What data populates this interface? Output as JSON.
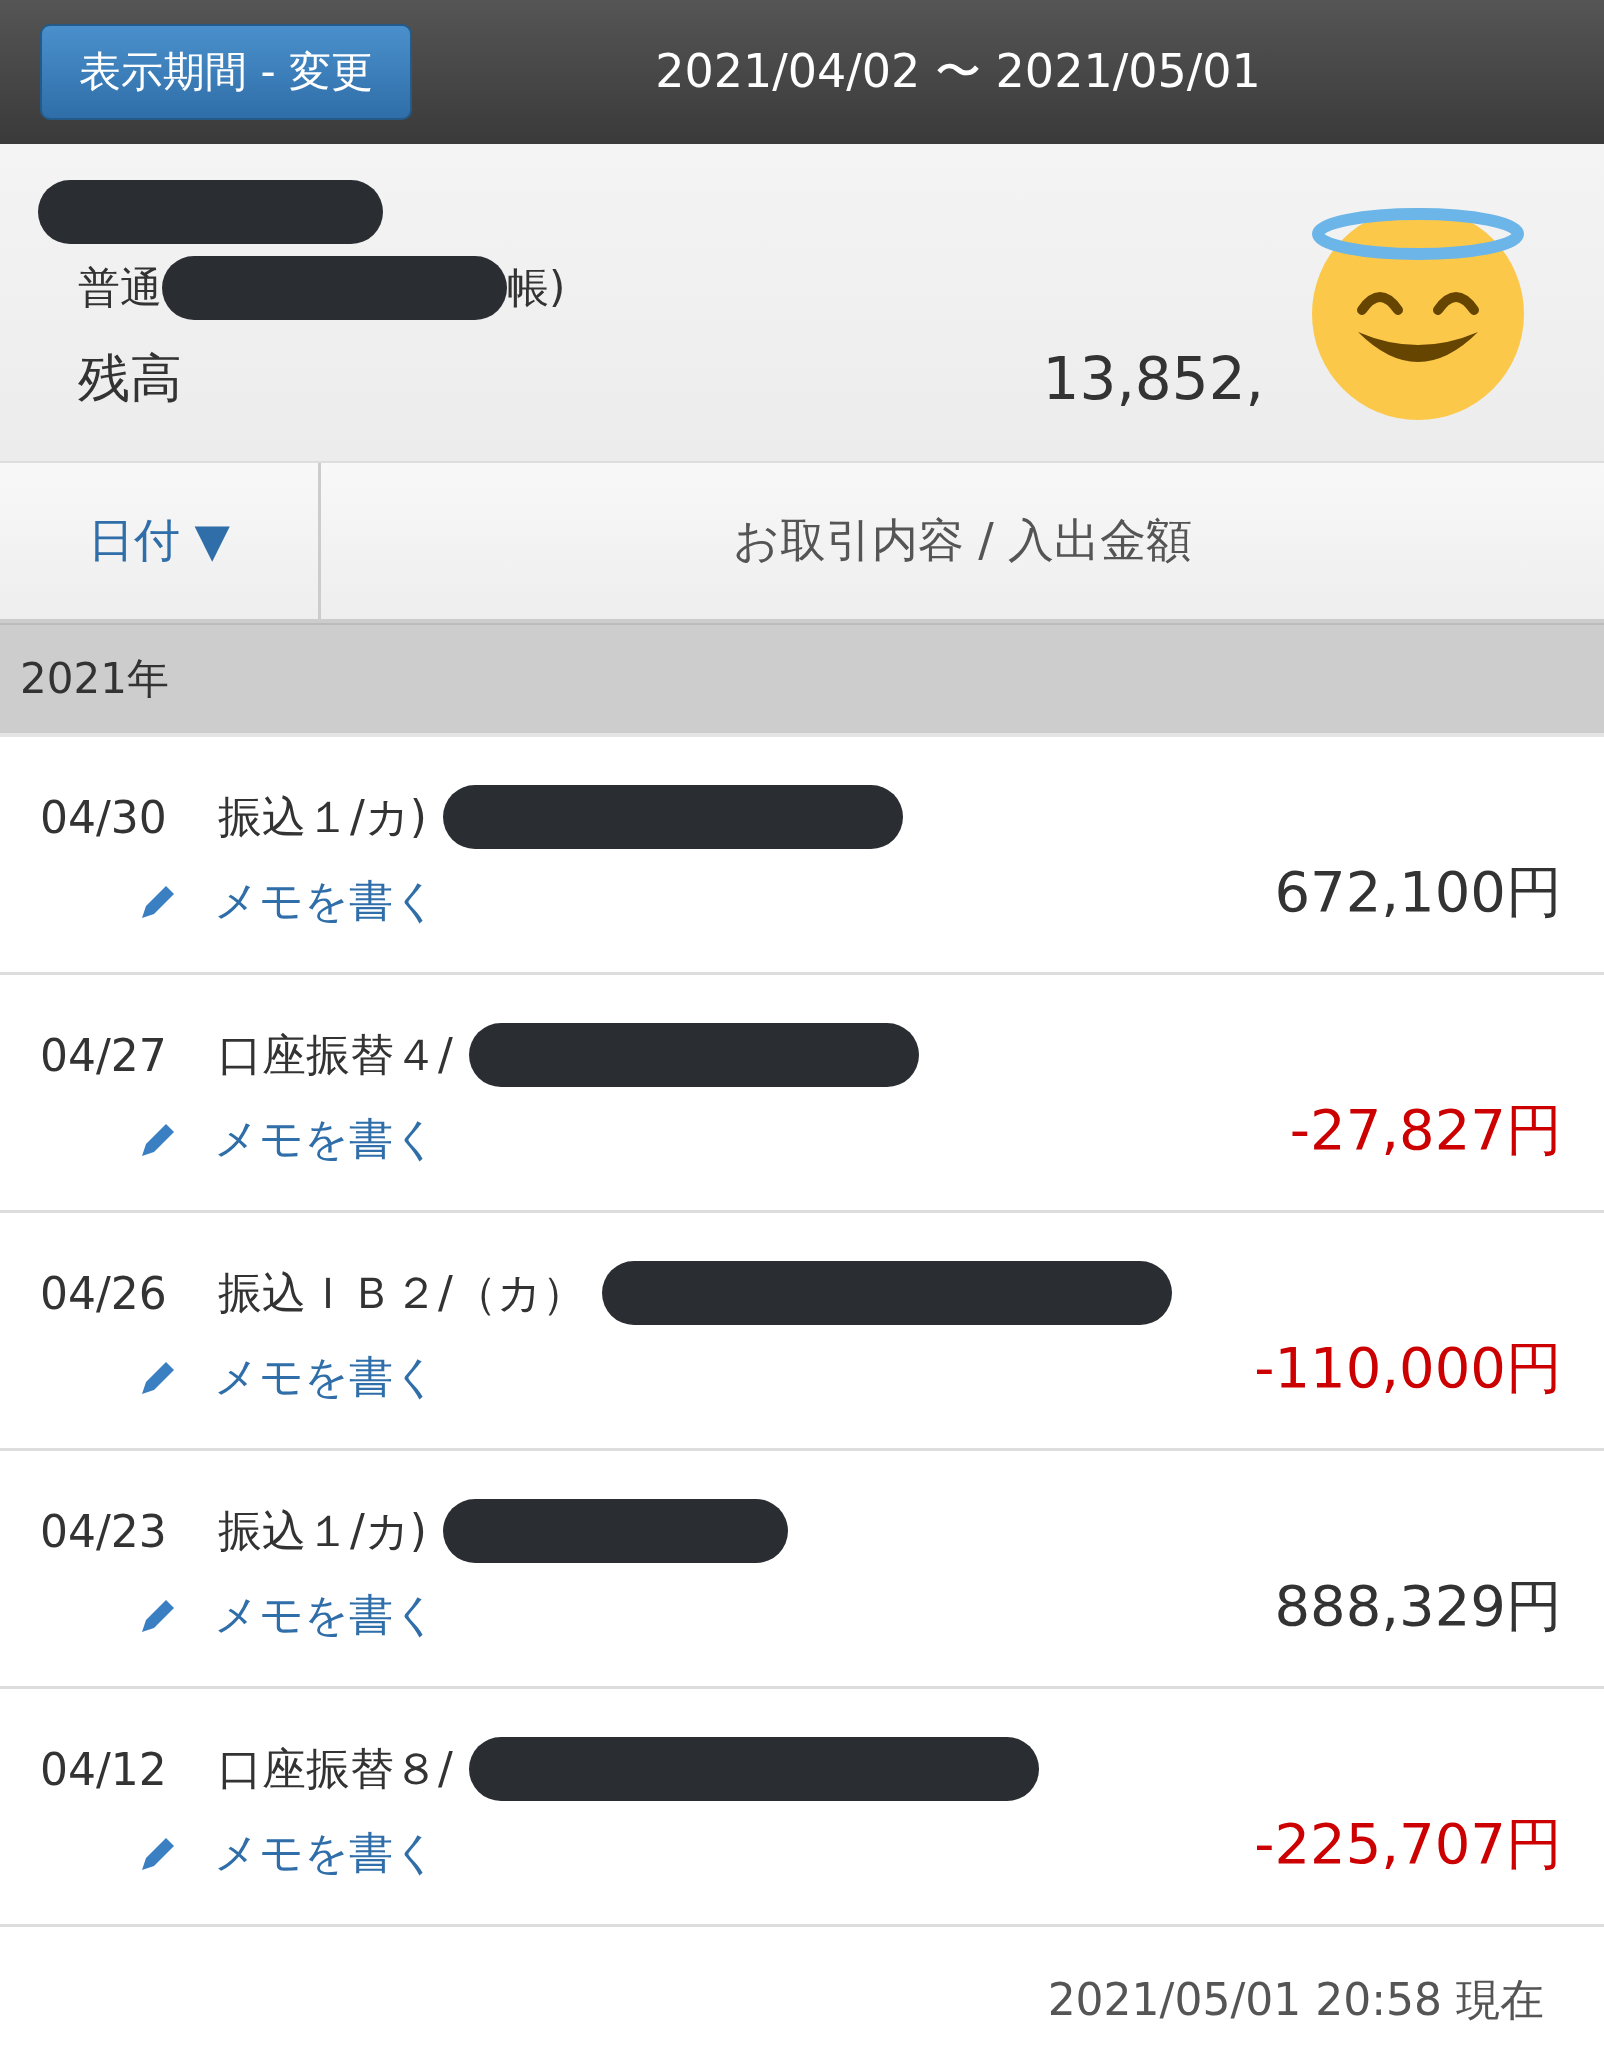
{
  "header": {
    "period_button": "表示期間 - 変更",
    "period_range": "2021/04/02 〜 2021/05/01"
  },
  "account": {
    "type_prefix": "普通",
    "type_suffix": "帳)",
    "balance_label": "残高",
    "balance_value": "13,852,"
  },
  "columns": [
    {
      "label": "日付 ▼",
      "kind": "sort"
    },
    {
      "label": "お取引内容 / 入出金額",
      "kind": "plain"
    }
  ],
  "year": "2021年",
  "transactions": [
    {
      "date": "04/30",
      "description": "振込１/カ)",
      "memo": "メモを書く",
      "amount": "672,100円",
      "kind": "deposit"
    },
    {
      "date": "04/27",
      "description": "口座振替４/",
      "memo": "メモを書く",
      "amount": "-27,827円",
      "kind": "withdrawal"
    },
    {
      "date": "04/26",
      "description": "振込ＩＢ２/（カ）",
      "memo": "メモを書く",
      "amount": "-110,000円",
      "kind": "withdrawal"
    },
    {
      "date": "04/23",
      "description": "振込１/カ)",
      "memo": "メモを書く",
      "amount": "888,329円",
      "kind": "deposit"
    },
    {
      "date": "04/12",
      "description": "口座振替８/",
      "memo": "メモを書く",
      "amount": "-225,707円",
      "kind": "withdrawal"
    }
  ],
  "as_of": "2021/05/01 20:58 現在"
}
